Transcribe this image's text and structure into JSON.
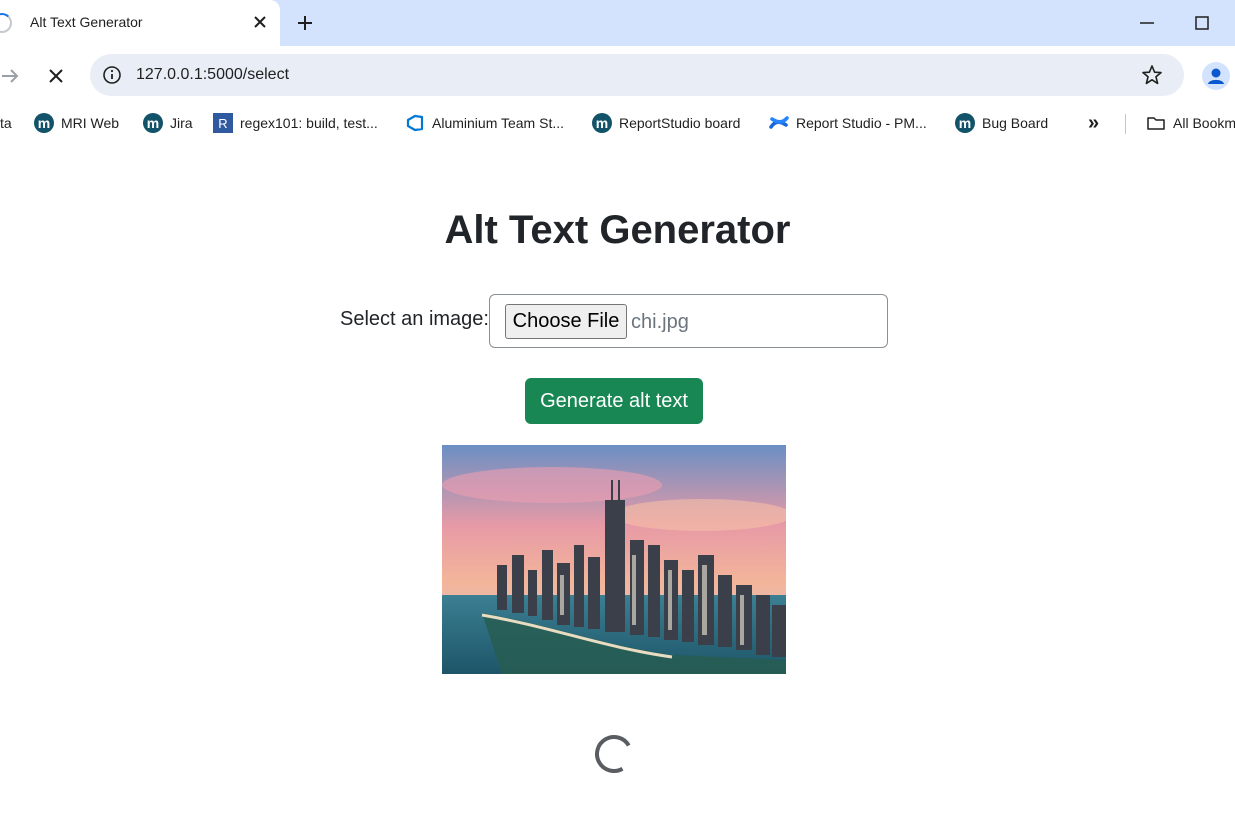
{
  "browser": {
    "tab_title": "Alt Text Generator",
    "url": "127.0.0.1:5000/select"
  },
  "bookmarks": [
    {
      "label": "ta",
      "icon": "truncated-icon"
    },
    {
      "label": "MRI Web",
      "icon": "mri-m-icon"
    },
    {
      "label": "Jira",
      "icon": "mri-m-icon"
    },
    {
      "label": "regex101: build, test...",
      "icon": "regex101-icon"
    },
    {
      "label": "Aluminium Team St...",
      "icon": "azure-devops-icon"
    },
    {
      "label": "ReportStudio board",
      "icon": "mri-m-icon"
    },
    {
      "label": "Report Studio - PM...",
      "icon": "confluence-icon"
    },
    {
      "label": "Bug Board",
      "icon": "mri-m-icon"
    }
  ],
  "bookmarks_overflow": "»",
  "all_bookmarks_label": "All Bookmarks",
  "page": {
    "title": "Alt Text Generator",
    "select_label": "Select an image:",
    "choose_file_label": "Choose File",
    "file_name": "chi.jpg",
    "generate_label": "Generate alt text",
    "preview_image": "chicago-skyline-image"
  },
  "colors": {
    "tabstrip": "#d3e3fd",
    "omnibox": "#e9eef6",
    "primary_button": "#198754",
    "text": "#212529"
  }
}
